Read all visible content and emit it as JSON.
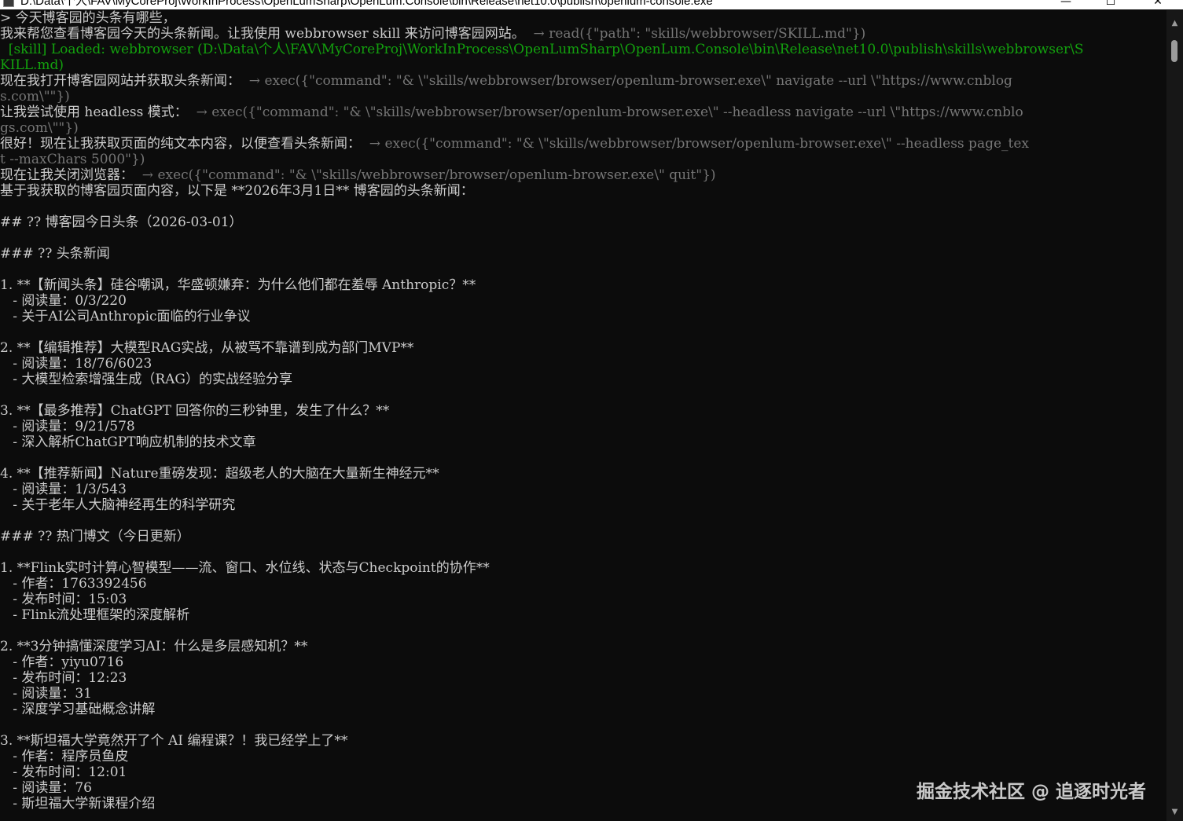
{
  "window": {
    "title": "D:\\Data\\个人\\FAV\\MyCoreProj\\WorkInProcess\\OpenLumSharp\\OpenLum.Console\\bin\\Release\\net10.0\\publish\\openlum-console.exe",
    "minimize_glyph": "—",
    "maximize_glyph": "☐",
    "close_glyph": "✕"
  },
  "console": {
    "lines": [
      {
        "text": "> 今天博客园的头条有哪些，",
        "tool": ""
      },
      {
        "text": "我来帮您查看博客园今天的头条新闻。让我使用 webbrowser skill 来访问博客园网站。",
        "tool": "  → read({\"path\": \"skills/webbrowser/SKILL.md\"})"
      },
      {
        "text": "  [skill] Loaded: webbrowser (D:\\Data\\个人\\FAV\\MyCoreProj\\WorkInProcess\\OpenLumSharp\\OpenLum.Console\\bin\\Release\\net10.0\\publish\\skills\\webbrowser\\S",
        "tool": ""
      },
      {
        "text": "KILL.md)",
        "tool": ""
      },
      {
        "text": "现在我打开博客园网站并获取头条新闻：",
        "tool": "  → exec({\"command\": \"& \\\"skills/webbrowser/browser/openlum-browser.exe\\\" navigate --url \\\"https://www.cnblog"
      },
      {
        "text": "",
        "tool": "s.com\\\"\"})"
      },
      {
        "text": "让我尝试使用 headless 模式：",
        "tool": "  → exec({\"command\": \"& \\\"skills/webbrowser/browser/openlum-browser.exe\\\" --headless navigate --url \\\"https://www.cnblo"
      },
      {
        "text": "",
        "tool": "gs.com\\\"\"})"
      },
      {
        "text": "很好！现在让我获取页面的纯文本内容，以便查看头条新闻：",
        "tool": "  → exec({\"command\": \"& \\\"skills/webbrowser/browser/openlum-browser.exe\\\" --headless page_tex"
      },
      {
        "text": "",
        "tool": "t --maxChars 5000\"})"
      },
      {
        "text": "现在让我关闭浏览器：",
        "tool": "  → exec({\"command\": \"& \\\"skills/webbrowser/browser/openlum-browser.exe\\\" quit\"})"
      },
      {
        "text": "基于我获取的博客园页面内容，以下是 **2026年3月1日** 博客园的头条新闻：",
        "tool": ""
      },
      {
        "text": "",
        "tool": ""
      },
      {
        "text": "## ?? 博客园今日头条（2026-03-01）",
        "tool": ""
      },
      {
        "text": "",
        "tool": ""
      },
      {
        "text": "### ?? 头条新闻",
        "tool": ""
      },
      {
        "text": "",
        "tool": ""
      },
      {
        "text": "1. **【新闻头条】硅谷嘲讽，华盛顿嫌弃：为什么他们都在羞辱 Anthropic？**",
        "tool": ""
      },
      {
        "text": "   - 阅读量：0/3/220",
        "tool": ""
      },
      {
        "text": "   - 关于AI公司Anthropic面临的行业争议",
        "tool": ""
      },
      {
        "text": "",
        "tool": ""
      },
      {
        "text": "2. **【编辑推荐】大模型RAG实战，从被骂不靠谱到成为部门MVP**",
        "tool": ""
      },
      {
        "text": "   - 阅读量：18/76/6023",
        "tool": ""
      },
      {
        "text": "   - 大模型检索增强生成（RAG）的实战经验分享",
        "tool": ""
      },
      {
        "text": "",
        "tool": ""
      },
      {
        "text": "3. **【最多推荐】ChatGPT 回答你的三秒钟里，发生了什么？**",
        "tool": ""
      },
      {
        "text": "   - 阅读量：9/21/578",
        "tool": ""
      },
      {
        "text": "   - 深入解析ChatGPT响应机制的技术文章",
        "tool": ""
      },
      {
        "text": "",
        "tool": ""
      },
      {
        "text": "4. **【推荐新闻】Nature重磅发现：超级老人的大脑在大量新生神经元**",
        "tool": ""
      },
      {
        "text": "   - 阅读量：1/3/543",
        "tool": ""
      },
      {
        "text": "   - 关于老年人大脑神经再生的科学研究",
        "tool": ""
      },
      {
        "text": "",
        "tool": ""
      },
      {
        "text": "### ?? 热门博文（今日更新）",
        "tool": ""
      },
      {
        "text": "",
        "tool": ""
      },
      {
        "text": "1. **Flink实时计算心智模型——流、窗口、水位线、状态与Checkpoint的协作**",
        "tool": ""
      },
      {
        "text": "   - 作者：1763392456",
        "tool": ""
      },
      {
        "text": "   - 发布时间：15:03",
        "tool": ""
      },
      {
        "text": "   - Flink流处理框架的深度解析",
        "tool": ""
      },
      {
        "text": "",
        "tool": ""
      },
      {
        "text": "2. **3分钟搞懂深度学习AI：什么是多层感知机？**",
        "tool": ""
      },
      {
        "text": "   - 作者：yiyu0716",
        "tool": ""
      },
      {
        "text": "   - 发布时间：12:23",
        "tool": ""
      },
      {
        "text": "   - 阅读量：31",
        "tool": ""
      },
      {
        "text": "   - 深度学习基础概念讲解",
        "tool": ""
      },
      {
        "text": "",
        "tool": ""
      },
      {
        "text": "3. **斯坦福大学竟然开了个 AI 编程课？！我已经学上了**",
        "tool": ""
      },
      {
        "text": "   - 作者：程序员鱼皮",
        "tool": ""
      },
      {
        "text": "   - 发布时间：12:01",
        "tool": ""
      },
      {
        "text": "   - 阅读量：76",
        "tool": ""
      },
      {
        "text": "   - 斯坦福大学新课程介绍",
        "tool": ""
      }
    ]
  },
  "scrollbar": {
    "up_glyph": "▲",
    "down_glyph": "▼"
  },
  "watermark": "掘金技术社区 @ 追逐时光者",
  "colors": {
    "background": "#0c0c0c",
    "text": "#cccccc",
    "tool_call": "#767676",
    "skill_loaded": "#13a10e"
  }
}
